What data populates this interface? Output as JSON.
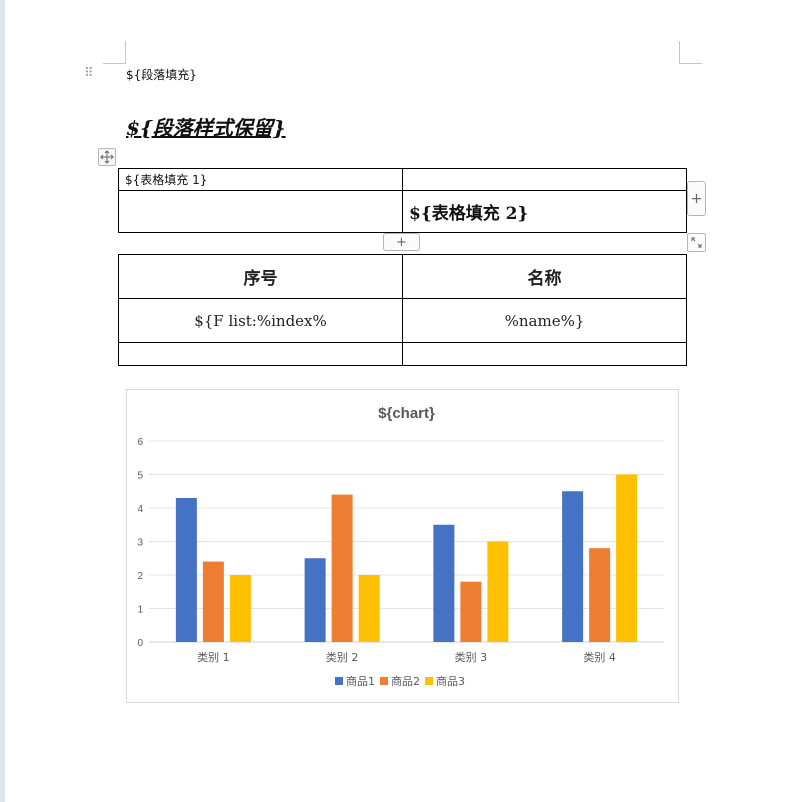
{
  "document": {
    "paragraph_fill": "${段落填充}",
    "paragraph_style_keep": "${段落样式保留}"
  },
  "table1": {
    "rows": [
      [
        "${表格填充 1}",
        ""
      ],
      [
        "",
        "${表格填充 2}"
      ]
    ]
  },
  "table2": {
    "headers": [
      "序号",
      "名称"
    ],
    "rows": [
      [
        "${F list:%index%",
        "%name%}"
      ],
      [
        "",
        ""
      ]
    ]
  },
  "editor_controls": {
    "add_column": "+",
    "add_row": "+"
  },
  "chart_data": {
    "type": "bar",
    "title": "${chart}",
    "categories": [
      "类别 1",
      "类别 2",
      "类别 3",
      "类别 4"
    ],
    "series": [
      {
        "name": "商品1",
        "color": "#4472C4",
        "values": [
          4.3,
          2.5,
          3.5,
          4.5
        ]
      },
      {
        "name": "商品2",
        "color": "#ED7D31",
        "values": [
          2.4,
          4.4,
          1.8,
          2.8
        ]
      },
      {
        "name": "商品3",
        "color": "#FFC000",
        "values": [
          2,
          2,
          3,
          5
        ]
      }
    ],
    "ylim": [
      0,
      6
    ],
    "yticks": [
      0,
      1,
      2,
      3,
      4,
      5,
      6
    ],
    "grid": true,
    "legend": "bottom"
  }
}
